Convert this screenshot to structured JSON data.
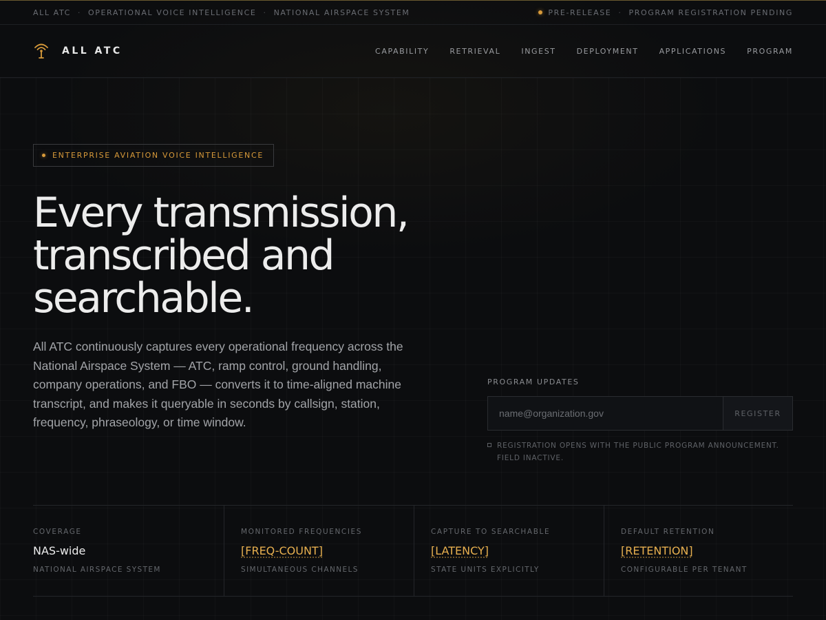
{
  "topbar": {
    "left": [
      "ALL ATC",
      "OPERATIONAL VOICE INTELLIGENCE",
      "NATIONAL AIRSPACE SYSTEM"
    ],
    "status": "PRE-RELEASE",
    "registration": "PROGRAM REGISTRATION PENDING"
  },
  "brand": {
    "name": "ALL ATC",
    "icon": "radio-tower-icon"
  },
  "nav": {
    "items": [
      "CAPABILITY",
      "RETRIEVAL",
      "INGEST",
      "DEPLOYMENT",
      "APPLICATIONS",
      "PROGRAM"
    ]
  },
  "hero": {
    "badge": "ENTERPRISE AVIATION VOICE INTELLIGENCE",
    "title_lines": [
      "Every transmission,",
      "transcribed and",
      "searchable."
    ],
    "description": "All ATC continuously captures every operational frequency across the National Airspace System — ATC, ramp control, ground handling, company operations, and FBO — converts it to time-aligned machine transcript, and makes it queryable in seconds by callsign, station, frequency, phraseology, or time window."
  },
  "updates": {
    "label": "PROGRAM UPDATES",
    "placeholder": "name@organization.gov",
    "value": "",
    "button": "REGISTER",
    "note": "REGISTRATION OPENS WITH THE PUBLIC PROGRAM ANNOUNCEMENT. FIELD INACTIVE."
  },
  "stats": [
    {
      "key": "COVERAGE",
      "value": "NAS-wide",
      "sub": "NATIONAL AIRSPACE SYSTEM"
    },
    {
      "key": "MONITORED FREQUENCIES",
      "value": "[FREQ-COUNT]",
      "sub": "SIMULTANEOUS CHANNELS"
    },
    {
      "key": "CAPTURE TO SEARCHABLE",
      "value": "[LATENCY]",
      "sub": "STATE UNITS EXPLICITLY"
    },
    {
      "key": "DEFAULT RETENTION",
      "value": "[RETENTION]",
      "sub": "CONFIGURABLE PER TENANT"
    }
  ],
  "colors": {
    "accent": "#d89a3a",
    "placeholder_value": "#e8b04f",
    "background": "#0c0d0f"
  }
}
